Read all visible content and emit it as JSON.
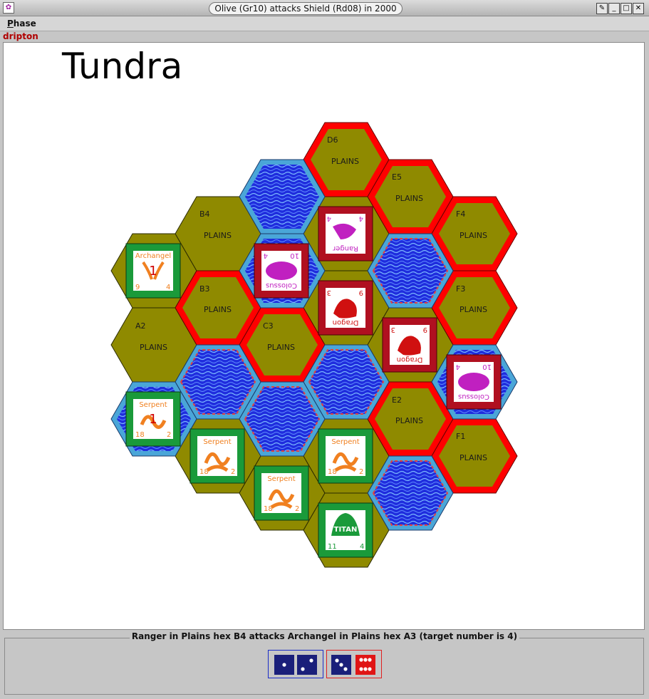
{
  "window": {
    "title": "Olive (Gr10) attacks Shield (Rd08) in 2000",
    "icon": "gear-icon",
    "controls": [
      "pin-icon",
      "minimize-icon",
      "maximize-icon",
      "close-icon"
    ]
  },
  "menu": {
    "items": [
      "Phase"
    ]
  },
  "player": "dripton",
  "terrain": "Tundra",
  "colors": {
    "plains": "#8f8a00",
    "swamp_fill": "#2233dd",
    "swamp_edge": "#4aa6d8",
    "hazard_red": "#ff0000",
    "green_legion": "#1a9a3a",
    "red_legion": "#b01020"
  },
  "hexes": {
    "D6": {
      "label": "D6",
      "terrain": "PLAINS"
    },
    "E5": {
      "label": "E5",
      "terrain": "PLAINS"
    },
    "F4": {
      "label": "F4",
      "terrain": "PLAINS"
    },
    "B4": {
      "label": "B4",
      "terrain": "PLAINS"
    },
    "B3": {
      "label": "B3",
      "terrain": "PLAINS"
    },
    "F3": {
      "label": "F3",
      "terrain": "PLAINS"
    },
    "A2": {
      "label": "A2",
      "terrain": "PLAINS"
    },
    "C3": {
      "label": "C3",
      "terrain": "PLAINS"
    },
    "E2": {
      "label": "E2",
      "terrain": "PLAINS"
    },
    "F1": {
      "label": "F1",
      "terrain": "PLAINS"
    }
  },
  "chits": {
    "archangel": {
      "name": "Archangel",
      "power": "9",
      "skill": "4",
      "hits": "1"
    },
    "serpent_damaged": {
      "name": "Serpent",
      "power": "18",
      "skill": "2",
      "hits": "1"
    },
    "serpent_b": {
      "name": "Serpent",
      "power": "18",
      "skill": "2"
    },
    "serpent_c": {
      "name": "Serpent",
      "power": "18",
      "skill": "2"
    },
    "serpent_d": {
      "name": "Serpent",
      "power": "18",
      "skill": "2"
    },
    "titan": {
      "name": "TITAN",
      "power": "11",
      "skill": "4"
    },
    "ranger": {
      "name": "Ranger",
      "power": "4",
      "skill": "4"
    },
    "colossus_a": {
      "name": "Colossus",
      "power": "10",
      "skill": "4"
    },
    "colossus_b": {
      "name": "Colossus",
      "power": "10",
      "skill": "4"
    },
    "dragon_a": {
      "name": "Dragon",
      "power": "9",
      "skill": "3"
    },
    "dragon_b": {
      "name": "Dragon",
      "power": "9",
      "skill": "3"
    }
  },
  "strike": {
    "message": "Ranger in Plains hex B4 attacks Archangel in Plains hex A3 (target number is 4)",
    "misses": [
      1,
      2
    ],
    "hits_label": "",
    "red_dice": [
      3,
      6
    ]
  }
}
